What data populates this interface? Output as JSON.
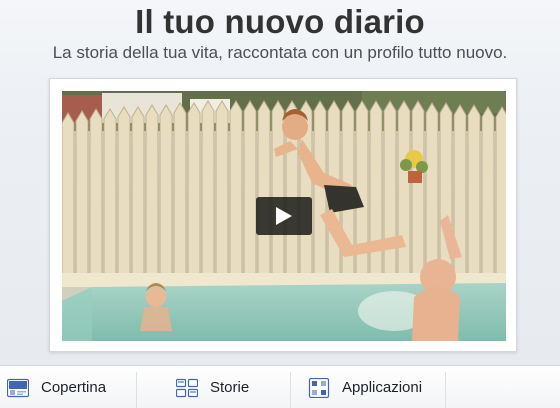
{
  "header": {
    "title": "Il tuo nuovo diario",
    "subtitle": "La storia della tua vita, raccontata con un profilo tutto nuovo."
  },
  "video": {
    "thumbnail": "boy-jumping-into-pool-photo",
    "play_icon": "play-icon"
  },
  "tabs": [
    {
      "label": "Copertina",
      "icon": "cover-icon"
    },
    {
      "label": "Storie",
      "icon": "stories-icon"
    },
    {
      "label": "Applicazioni",
      "icon": "apps-icon"
    }
  ],
  "colors": {
    "accent": "#4267b2",
    "text": "#333333"
  }
}
